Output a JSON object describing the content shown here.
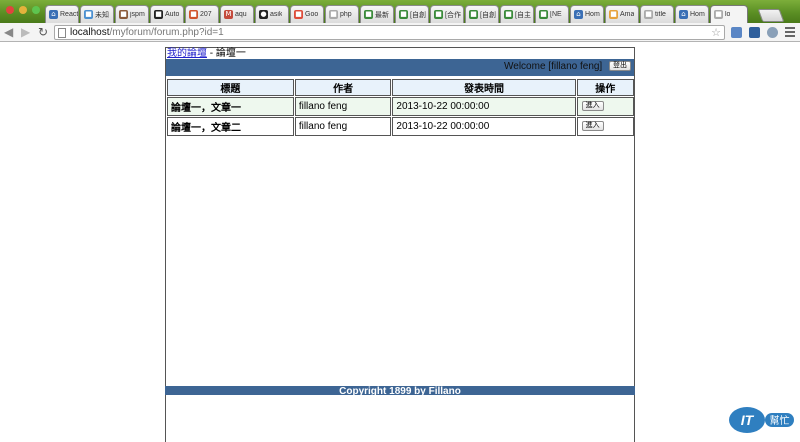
{
  "browser": {
    "tabs": [
      {
        "label": "React",
        "icon": "home-icon",
        "color": "#3a6fb5"
      },
      {
        "label": "未知",
        "icon": "doc-icon",
        "color": "#4a8fd0"
      },
      {
        "label": "jspm",
        "icon": "doc-icon",
        "color": "#8a5a3a"
      },
      {
        "label": "Auto",
        "icon": "doc-icon",
        "color": "#222222"
      },
      {
        "label": "207",
        "icon": "doc-icon",
        "color": "#d0542c"
      },
      {
        "label": "aqu",
        "icon": "mail-icon",
        "color": "#c44a3c"
      },
      {
        "label": "asik",
        "icon": "github-icon",
        "color": "#222222"
      },
      {
        "label": "Goo",
        "icon": "doc-icon",
        "color": "#dd4b39"
      },
      {
        "label": "php",
        "icon": "doc-icon",
        "color": "#aaaaaa"
      },
      {
        "label": "最新",
        "icon": "doc-icon",
        "color": "#3a8a3a"
      },
      {
        "label": "[自創",
        "icon": "doc-icon",
        "color": "#3a8a3a"
      },
      {
        "label": "[合作",
        "icon": "doc-icon",
        "color": "#3a8a3a"
      },
      {
        "label": "[自創",
        "icon": "doc-icon",
        "color": "#3a8a3a"
      },
      {
        "label": "[自主",
        "icon": "doc-icon",
        "color": "#3a8a3a"
      },
      {
        "label": "[NE",
        "icon": "doc-icon",
        "color": "#3a8a3a"
      },
      {
        "label": "Hom",
        "icon": "home-icon",
        "color": "#3a6fb5"
      },
      {
        "label": "Ama",
        "icon": "doc-icon",
        "color": "#e6a23c"
      },
      {
        "label": "title",
        "icon": "doc-icon",
        "color": "#aaaaaa"
      },
      {
        "label": "Hom",
        "icon": "home-icon",
        "color": "#3a6fb5"
      },
      {
        "label": "lo",
        "icon": "doc-icon",
        "color": "#aaaaaa"
      }
    ],
    "url_host": "localhost",
    "url_path": "/myforum/forum.php?id=1"
  },
  "page": {
    "breadcrumb_home": "我的論壇",
    "breadcrumb_sep": " - ",
    "breadcrumb_current": "論壇一",
    "welcome": "Welcome [fillano feng]",
    "logout_label": "登出",
    "table": {
      "headers": [
        "標題",
        "作者",
        "發表時間",
        "操作"
      ],
      "rows": [
        {
          "title": "論壇一，文章一",
          "author": "fillano feng",
          "time": "2013-10-22 00:00:00",
          "action": "進入"
        },
        {
          "title": "論壇一，文章二",
          "author": "fillano feng",
          "time": "2013-10-22 00:00:00",
          "action": "進入"
        }
      ]
    },
    "footer": "Copyright 1899 by Fillano"
  },
  "watermark": {
    "text_main": "IT",
    "text_sub": "幫忙"
  },
  "colors": {
    "header_bar": "#3d6594",
    "table_header_bg": "#e8f2fb",
    "row_alt_bg": "#eef8ee",
    "link": "#2222cc"
  }
}
